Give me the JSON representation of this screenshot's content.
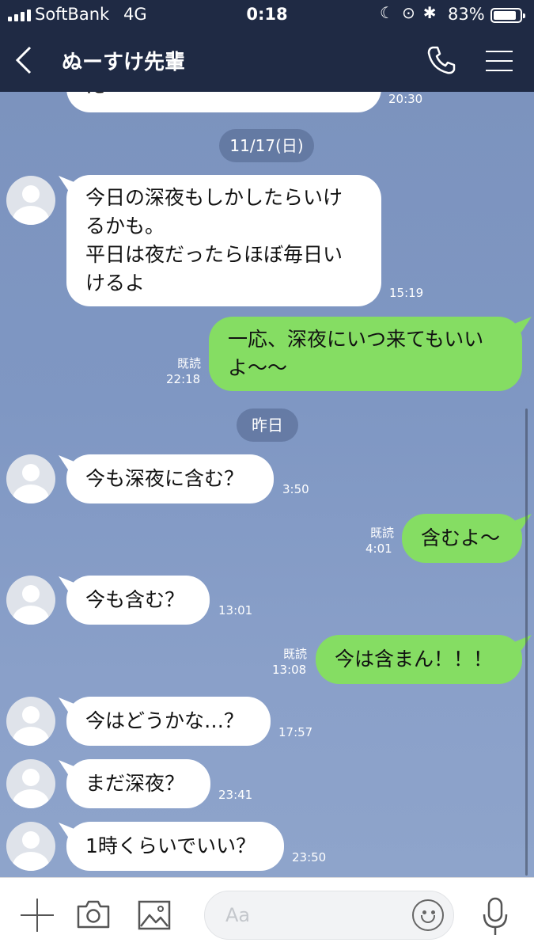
{
  "status": {
    "carrier": "SoftBank",
    "network": "4G",
    "time": "0:18",
    "battery": "83%"
  },
  "header": {
    "title": "ぬーすけ先輩",
    "back_icon": "chevron-left-icon",
    "call_icon": "phone-icon",
    "menu_icon": "hamburger-icon"
  },
  "chat": {
    "prev_time": "20:30",
    "date1": "11/17(日)",
    "msg1": {
      "text": "今日の深夜もしかしたらいけ\nるかも。\n平日は夜だったらほぼ毎日い\nけるよ",
      "time": "15:19"
    },
    "msg2": {
      "text": "一応、深夜にいつ来てもいい\nよ〜〜",
      "read": "既読",
      "time": "22:18"
    },
    "date2": "昨日",
    "msg3": {
      "text": "今も深夜に含む？",
      "time": "3:50"
    },
    "msg4": {
      "text": "含むよ〜",
      "read": "既読",
      "time": "4:01"
    },
    "msg5": {
      "text": "今も含む？",
      "time": "13:01"
    },
    "msg6": {
      "text": "今は含まん！！！",
      "read": "既読",
      "time": "13:08"
    },
    "msg7": {
      "text": "今はどうかな…？",
      "time": "17:57"
    },
    "msg8": {
      "text": "まだ深夜？",
      "time": "23:41"
    },
    "msg9": {
      "text": "1時くらいでいい？",
      "time": "23:50"
    }
  },
  "input": {
    "placeholder": "Aa"
  },
  "colors": {
    "header": "#1f2a44",
    "background": "#7f97c2",
    "outgoing": "#85dd63",
    "incoming": "#ffffff"
  }
}
